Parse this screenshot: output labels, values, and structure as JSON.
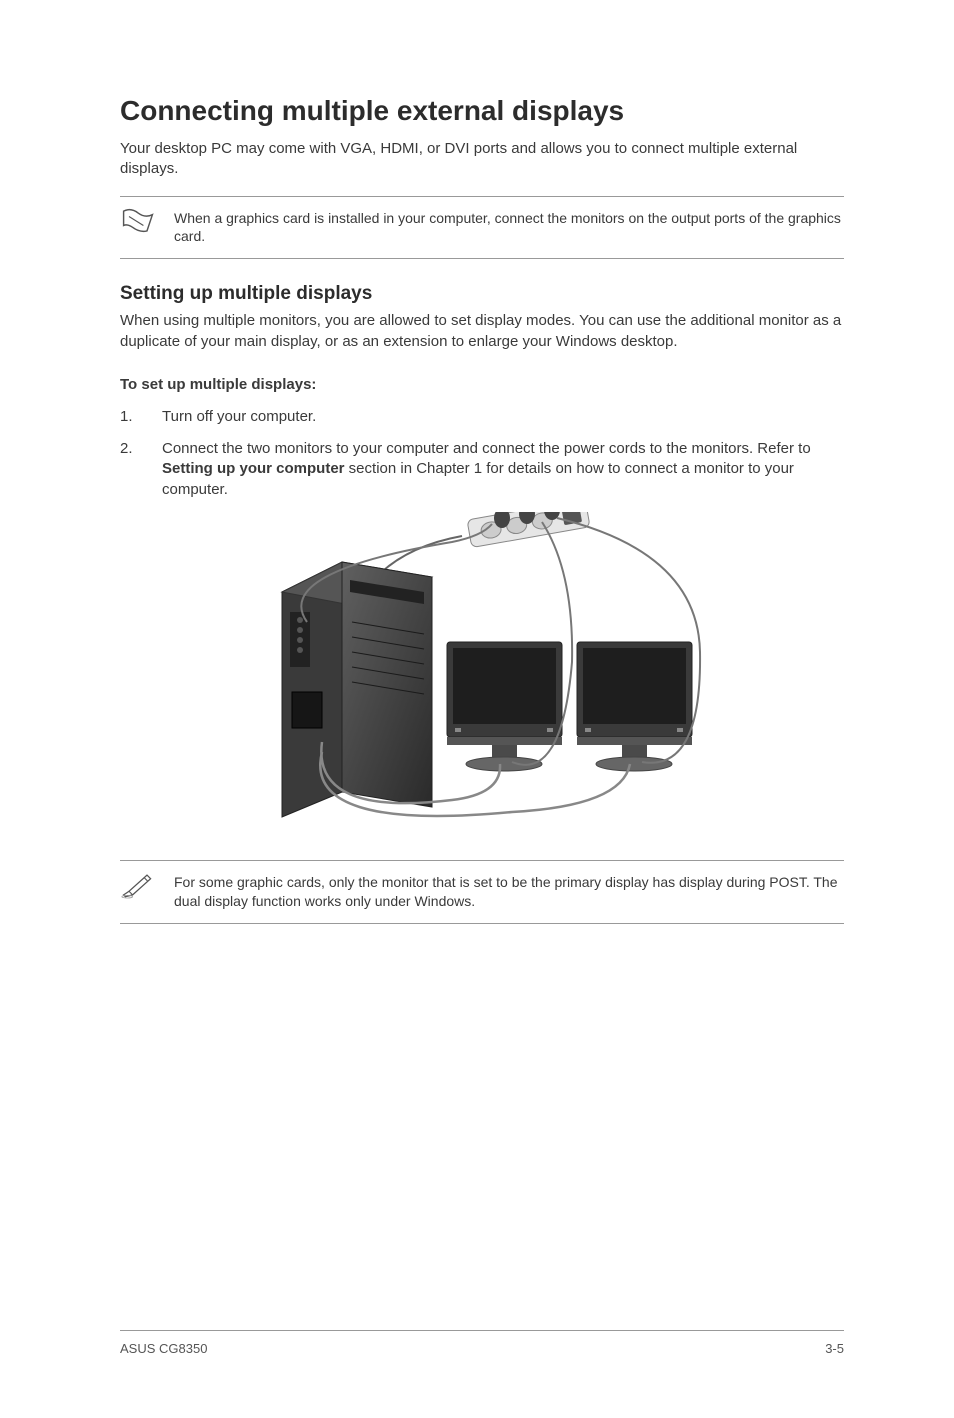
{
  "title": "Connecting multiple external displays",
  "intro": "Your desktop PC may come with VGA, HDMI, or DVI ports and allows you to connect multiple external displays.",
  "note1": "When a graphics card is installed in your computer, connect the monitors on the output ports of the graphics card.",
  "subheading": "Setting up multiple displays",
  "sub_intro": "When using multiple monitors, you are allowed to set display modes. You can use the additional monitor as a duplicate of your main display, or as an extension to enlarge your Windows desktop.",
  "setup_title": "To set up multiple displays:",
  "steps": [
    {
      "num": "1.",
      "text": "Turn off your computer."
    },
    {
      "num": "2.",
      "pre": "Connect the two monitors to your computer and connect the power cords to the monitors. Refer to ",
      "bold": "Setting up your computer",
      "post": " section in Chapter 1 for details on how to connect a monitor to your computer."
    }
  ],
  "note2": "For some graphic cards, only the monitor that is set to be the primary display has display during POST. The dual display function works only under Windows.",
  "footer_left": "ASUS CG8350",
  "footer_right": "3-5"
}
